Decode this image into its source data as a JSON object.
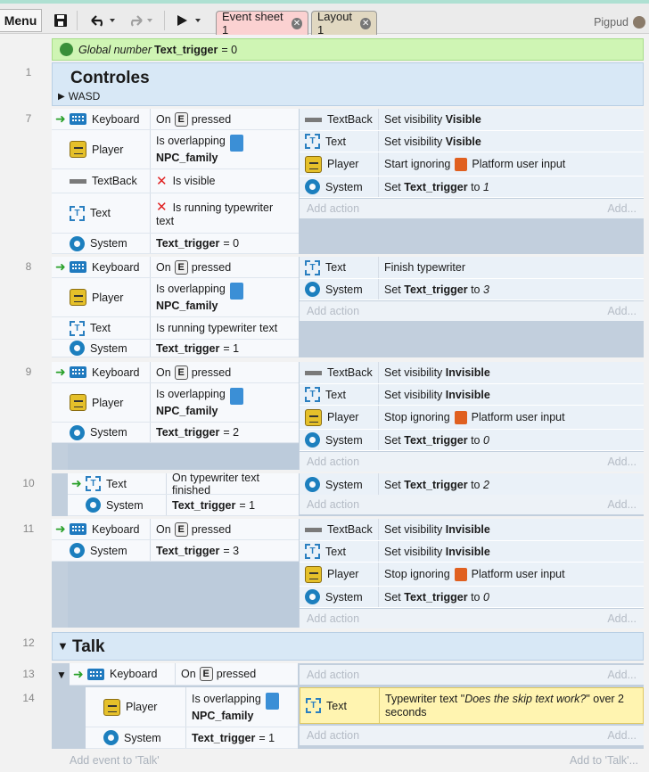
{
  "toolbar": {
    "menu": "Menu",
    "tabs": [
      "Event sheet 1",
      "Layout 1"
    ],
    "project": "Pigpud"
  },
  "global": {
    "label": "Global number",
    "name": "Text_trigger",
    "val": "= 0"
  },
  "groups": {
    "controles": {
      "num": "1",
      "title": "Controles",
      "sub": "WASD"
    },
    "talk": {
      "num": "12",
      "title": "Talk"
    }
  },
  "add_action": "Add action",
  "add": "Add...",
  "add_event_talk": "Add event to 'Talk'",
  "add_to_talk": "Add to 'Talk'...",
  "events": {
    "e7": {
      "num": "7",
      "conds": [
        {
          "obj": "Keyboard",
          "a": "On",
          "key": "E",
          "b": "pressed"
        },
        {
          "obj": "Player",
          "a": "Is overlapping",
          "b": "NPC_family"
        },
        {
          "obj": "TextBack",
          "a": "Is visible"
        },
        {
          "obj": "Text",
          "a": "Is running typewriter",
          "b": "text"
        },
        {
          "obj": "System",
          "a": "Text_trigger",
          "b": "= 0"
        }
      ],
      "acts": [
        {
          "obj": "TextBack",
          "a": "Set visibility",
          "b": "Visible"
        },
        {
          "obj": "Text",
          "a": "Set visibility",
          "b": "Visible"
        },
        {
          "obj": "Player",
          "a": "Start ignoring",
          "b": "Platform user input"
        },
        {
          "obj": "System",
          "a": "Set",
          "b": "Text_trigger",
          "c": "to",
          "d": "1"
        }
      ]
    },
    "e8": {
      "num": "8",
      "conds": [
        {
          "obj": "Keyboard",
          "a": "On",
          "key": "E",
          "b": "pressed"
        },
        {
          "obj": "Player",
          "a": "Is overlapping",
          "b": "NPC_family"
        },
        {
          "obj": "Text",
          "a": "Is running typewriter text"
        },
        {
          "obj": "System",
          "a": "Text_trigger",
          "b": "= 1"
        }
      ],
      "acts": [
        {
          "obj": "Text",
          "a": "Finish typewriter"
        },
        {
          "obj": "System",
          "a": "Set",
          "b": "Text_trigger",
          "c": "to",
          "d": "3"
        }
      ]
    },
    "e9": {
      "num": "9",
      "conds": [
        {
          "obj": "Keyboard",
          "a": "On",
          "key": "E",
          "b": "pressed"
        },
        {
          "obj": "Player",
          "a": "Is overlapping",
          "b": "NPC_family"
        },
        {
          "obj": "System",
          "a": "Text_trigger",
          "b": "= 2"
        }
      ],
      "acts": [
        {
          "obj": "TextBack",
          "a": "Set visibility",
          "b": "Invisible"
        },
        {
          "obj": "Text",
          "a": "Set visibility",
          "b": "Invisible"
        },
        {
          "obj": "Player",
          "a": "Stop ignoring",
          "b": "Platform user input"
        },
        {
          "obj": "System",
          "a": "Set",
          "b": "Text_trigger",
          "c": "to",
          "d": "0"
        }
      ]
    },
    "e10": {
      "num": "10",
      "conds": [
        {
          "obj": "Text",
          "a": "On typewriter text finished"
        },
        {
          "obj": "System",
          "a": "Text_trigger",
          "b": "= 1"
        }
      ],
      "acts": [
        {
          "obj": "System",
          "a": "Set",
          "b": "Text_trigger",
          "c": "to",
          "d": "2"
        }
      ]
    },
    "e11": {
      "num": "11",
      "conds": [
        {
          "obj": "Keyboard",
          "a": "On",
          "key": "E",
          "b": "pressed"
        },
        {
          "obj": "System",
          "a": "Text_trigger",
          "b": "= 3"
        }
      ],
      "acts": [
        {
          "obj": "TextBack",
          "a": "Set visibility",
          "b": "Invisible"
        },
        {
          "obj": "Text",
          "a": "Set visibility",
          "b": "Invisible"
        },
        {
          "obj": "Player",
          "a": "Stop ignoring",
          "b": "Platform user input"
        },
        {
          "obj": "System",
          "a": "Set",
          "b": "Text_trigger",
          "c": "to",
          "d": "0"
        }
      ]
    },
    "e13": {
      "num": "13",
      "conds": [
        {
          "obj": "Keyboard",
          "a": "On",
          "key": "E",
          "b": "pressed"
        }
      ]
    },
    "e14": {
      "num": "14",
      "conds": [
        {
          "obj": "Player",
          "a": "Is overlapping",
          "b": "NPC_family"
        },
        {
          "obj": "System",
          "a": "Text_trigger",
          "b": "= 1"
        }
      ],
      "acts": [
        {
          "obj": "Text",
          "a": "Typewriter text \"",
          "b": "Does the skip text work?",
          "c": "\" over 2",
          "d": "seconds"
        }
      ]
    }
  }
}
